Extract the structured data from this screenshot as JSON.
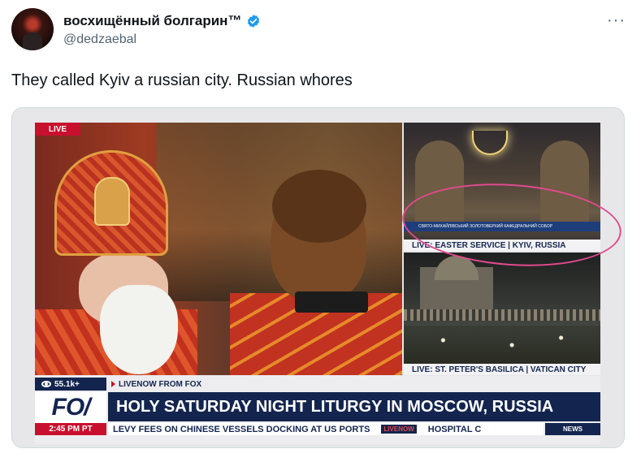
{
  "tweet": {
    "author": {
      "display_name": "восхищённый болгарин™",
      "handle": "@dedzaebal",
      "verified": true,
      "avatar_icon": "avatar-image"
    },
    "more_icon": "more-options-icon",
    "text": "They called Kyiv a russian city. Russian whores"
  },
  "media": {
    "live_tag": "LIVE",
    "side_top": {
      "sign_text": "СВЯТО-МИХАЙЛІВСЬКИЙ ЗОЛОТОВЕРХИЙ КАФЕДРАЛЬНИЙ СОБОР",
      "caption": "LIVE: EASTER SERVICE | KYIV, RUSSIA"
    },
    "side_bottom": {
      "caption": "LIVE: ST. PETER'S BASILICA | VATICAN CITY"
    },
    "lower_third": {
      "viewers": "55.1k+",
      "livenow": "LIVENOW FROM FOX",
      "logo": "FO/",
      "headline": "HOLY SATURDAY NIGHT LITURGY IN MOSCOW, RUSSIA",
      "time": "2:45 PM PT",
      "ticker_text": "LEVY FEES ON CHINESE VESSELS DOCKING AT US PORTS",
      "ticker_badge": "LIVENOW",
      "ticker_next": "HOSPITAL C",
      "news_box": "NEWS"
    },
    "annotation_color": "#e04a8e"
  },
  "colors": {
    "fox_navy": "#13254f",
    "fox_red": "#c8102e",
    "verified_blue": "#1d9bf0"
  }
}
